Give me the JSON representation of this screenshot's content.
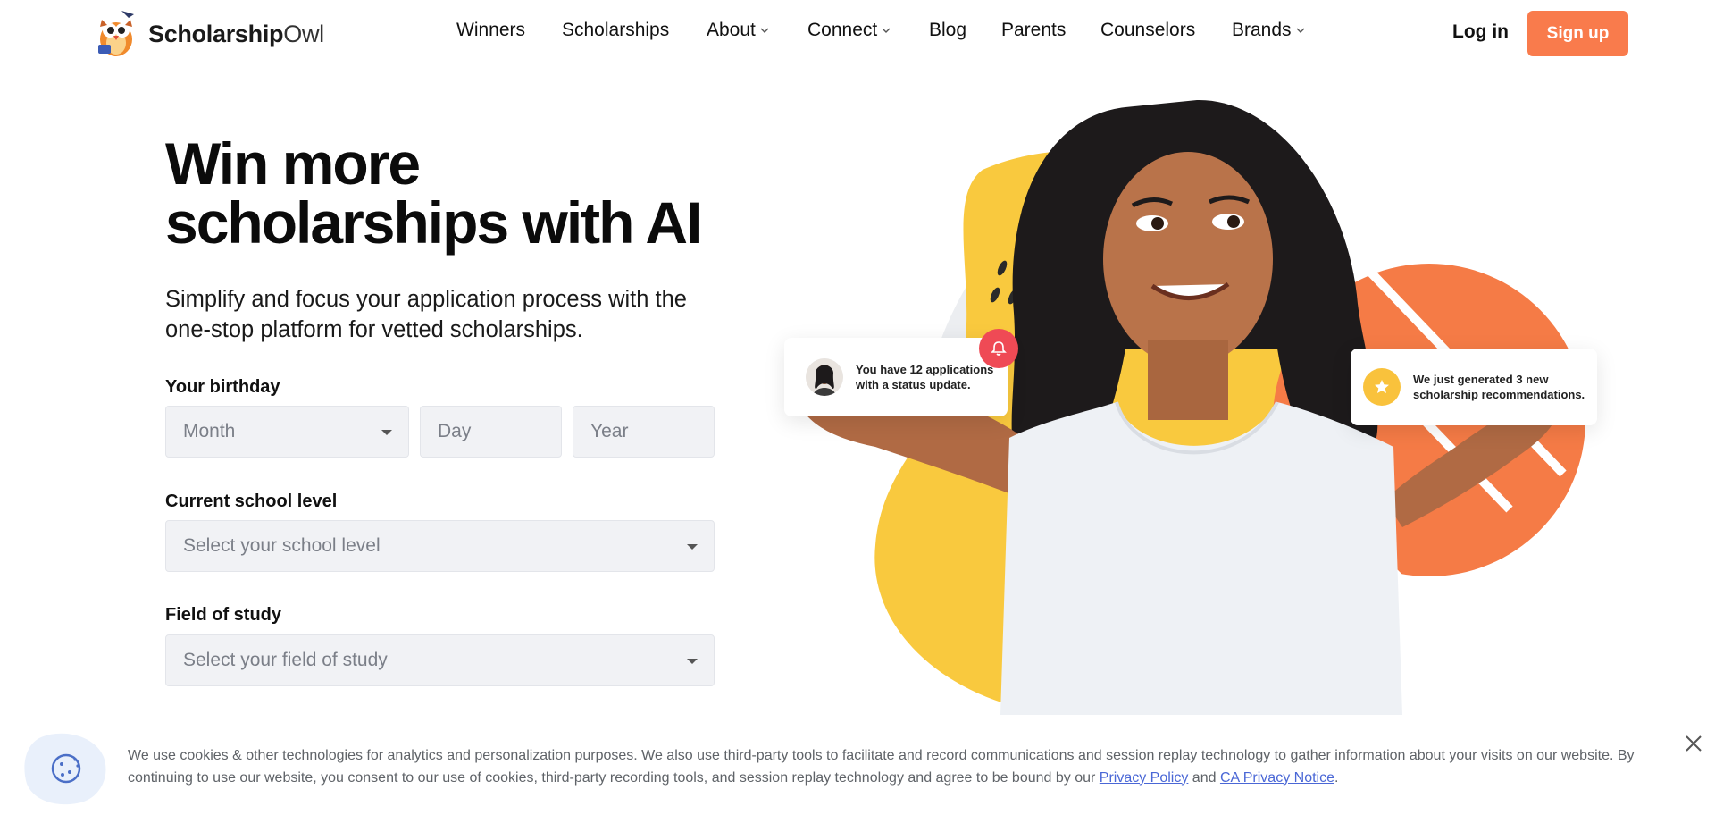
{
  "brand": {
    "name_bold": "Scholarship",
    "name_light": "Owl",
    "icon": "owl-logo-icon"
  },
  "nav": {
    "items": [
      {
        "label": "Winners",
        "dropdown": false
      },
      {
        "label": "Scholarships",
        "dropdown": false
      },
      {
        "label": "About",
        "dropdown": true
      },
      {
        "label": "Connect",
        "dropdown": true
      },
      {
        "label": "Blog",
        "dropdown": false
      },
      {
        "label": "Parents",
        "dropdown": false
      },
      {
        "label": "Counselors",
        "dropdown": false
      },
      {
        "label": "Brands",
        "dropdown": true
      }
    ],
    "login_label": "Log in",
    "signup_label": "Sign up"
  },
  "hero": {
    "title_line1": "Win more",
    "title_line2": "scholarships with AI",
    "subtitle": "Simplify and focus your application process with the one-stop platform for vetted scholarships."
  },
  "form": {
    "birthday_label": "Your birthday",
    "month_placeholder": "Month",
    "day_placeholder": "Day",
    "year_placeholder": "Year",
    "school_label": "Current school level",
    "school_placeholder": "Select your school level",
    "field_label": "Field of study",
    "field_placeholder": "Select your field of study"
  },
  "notifications": {
    "status_update": "You have 12 applications with a status update.",
    "recommendations": "We just generated 3 new scholarship recommendations."
  },
  "cookie": {
    "text": "We use cookies & other technologies for analytics and personalization purposes. We also use third-party tools to facilitate and record communications and session replay technology to gather information about your visits on our website. By continuing to use our website, you consent to our use of cookies, third-party recording tools, and session replay technology and agree to be bound by our ",
    "privacy_link": "Privacy Policy",
    "and": " and ",
    "ca_link": "CA Privacy Notice",
    "end": "."
  },
  "colors": {
    "accent": "#f97b4c",
    "yellow": "#f9c23c",
    "bell": "#ef4a55",
    "link": "#4a67d6"
  }
}
